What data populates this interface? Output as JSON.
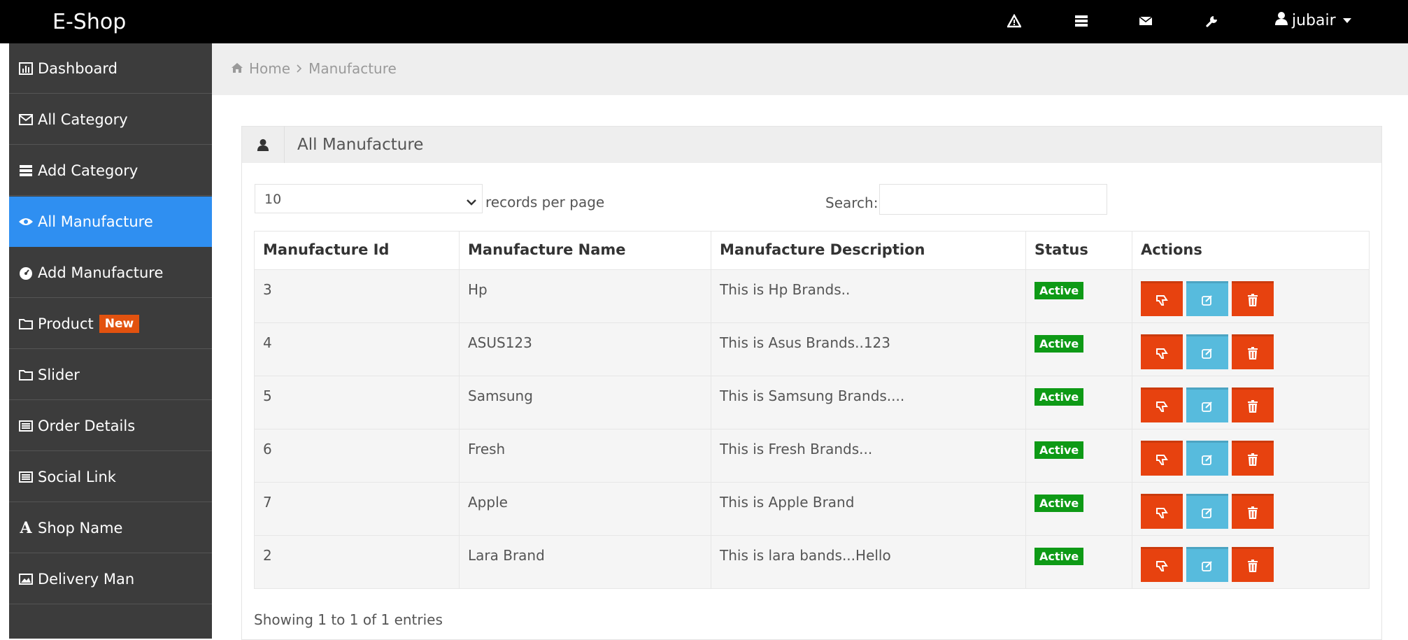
{
  "brand": "E-Shop",
  "topbar": {
    "icons": [
      "warning-icon",
      "tasks-icon",
      "envelope-icon",
      "wrench-icon"
    ],
    "user": "jubair"
  },
  "sidebar": {
    "items": [
      {
        "label": "Dashboard",
        "icon": "bar-chart-icon"
      },
      {
        "label": "All Category",
        "icon": "envelope-icon"
      },
      {
        "label": "Add Category",
        "icon": "tasks-icon"
      },
      {
        "label": "All Manufacture",
        "icon": "eye-icon",
        "active": true
      },
      {
        "label": "Add Manufacture",
        "icon": "dashboard-icon"
      },
      {
        "label": "Product",
        "icon": "folder-icon",
        "badge": "New"
      },
      {
        "label": "Slider",
        "icon": "folder-icon"
      },
      {
        "label": "Order Details",
        "icon": "list-icon"
      },
      {
        "label": "Social Link",
        "icon": "list-icon"
      },
      {
        "label": "Shop Name",
        "icon": "font-icon"
      },
      {
        "label": "Delivery Man",
        "icon": "picture-icon"
      }
    ]
  },
  "breadcrumb": {
    "home": "Home",
    "current": "Manufacture"
  },
  "panel": {
    "title": "All Manufacture"
  },
  "controls": {
    "page_length": "10",
    "records_per_page": "records per page",
    "search_label": "Search:",
    "search_value": ""
  },
  "table": {
    "headers": [
      "Manufacture Id",
      "Manufacture Name",
      "Manufacture Description",
      "Status",
      "Actions"
    ],
    "rows": [
      {
        "id": "3",
        "name": "Hp",
        "description": "This is Hp Brands..",
        "status": "Active"
      },
      {
        "id": "4",
        "name": "ASUS123",
        "description": "This is Asus Brands..123",
        "status": "Active"
      },
      {
        "id": "5",
        "name": "Samsung",
        "description": "This is Samsung Brands....",
        "status": "Active"
      },
      {
        "id": "6",
        "name": "Fresh",
        "description": "This is Fresh Brands...",
        "status": "Active"
      },
      {
        "id": "7",
        "name": "Apple",
        "description": "This is Apple Brand",
        "status": "Active"
      },
      {
        "id": "2",
        "name": "Lara Brand",
        "description": "This is lara bands...Hello",
        "status": "Active"
      }
    ]
  },
  "footer": {
    "showing": "Showing 1 to 1 of 1 entries"
  },
  "colors": {
    "topbar": "#000000",
    "sidebar": "#3c3c3c",
    "active": "#2f8ff1",
    "badge": "#e2520f",
    "status_active": "#0e9a16",
    "btn_red": "#e7420f",
    "btn_blue": "#57bbdd"
  }
}
